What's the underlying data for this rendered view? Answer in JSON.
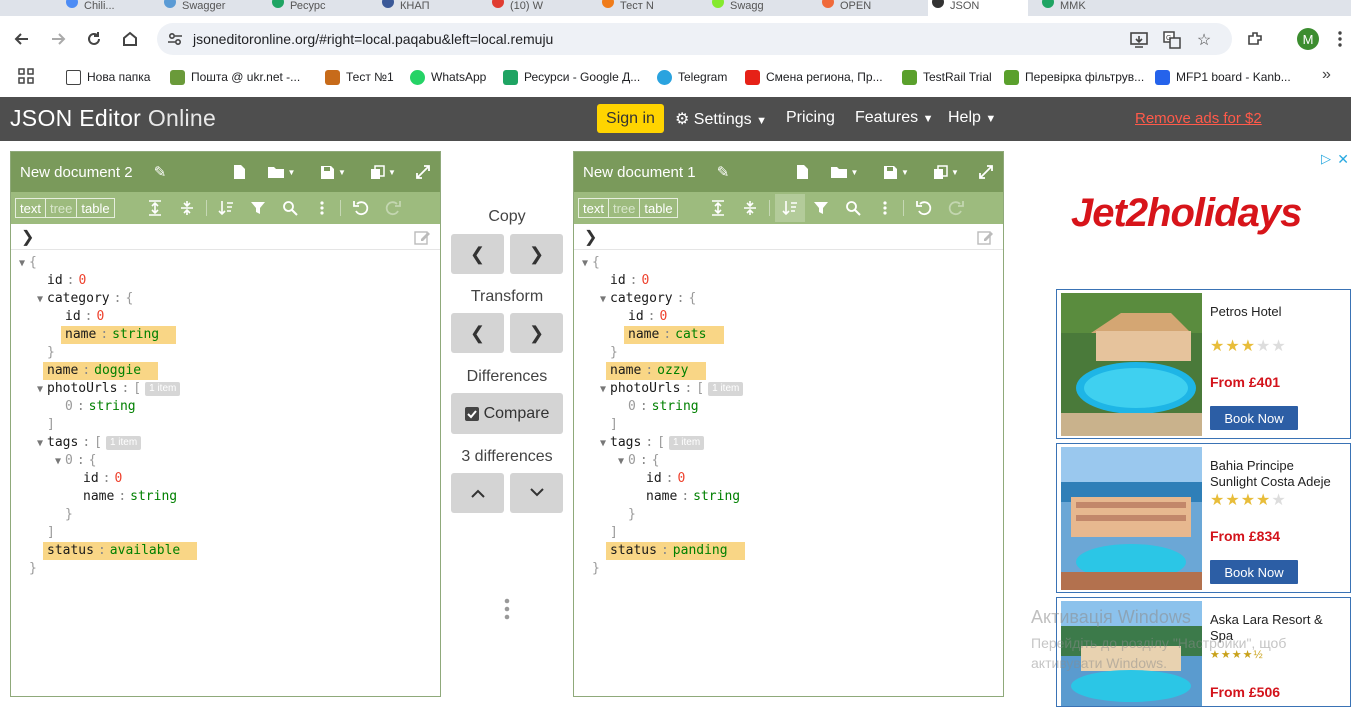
{
  "browser": {
    "tabs": [
      {
        "label": "Chili...",
        "color": "#4d8cf5"
      },
      {
        "label": "Swagger",
        "color": "#5b9bd5"
      },
      {
        "label": "Ресурс",
        "color": "#1fa463"
      },
      {
        "label": "КНАП",
        "color": "#3b5998"
      },
      {
        "label": "(10) W",
        "color": "#e03c31"
      },
      {
        "label": "Тест N",
        "color": "#f07c1a"
      },
      {
        "label": "Swagg",
        "color": "#85ea2d"
      },
      {
        "label": "OPEN",
        "color": "#f06a3a"
      },
      {
        "label": "JSON",
        "color": "#333333"
      },
      {
        "label": "MMK",
        "color": "#1fa463"
      }
    ],
    "url": "jsoneditoronline.org/#right=local.paqabu&left=local.remuju",
    "profile_initial": "M",
    "bookmarks": [
      {
        "label": "Нова папка",
        "icon": "folder-icon",
        "color": "#444444"
      },
      {
        "label": "Пошта @ ukr.net -...",
        "icon": "mail-icon",
        "color": "#6a9a3a"
      },
      {
        "label": "Тест №1",
        "icon": "test-icon",
        "color": "#c76b1a"
      },
      {
        "label": "WhatsApp",
        "icon": "whatsapp-icon",
        "color": "#25d366"
      },
      {
        "label": "Ресурси - Google Д...",
        "icon": "sheets-icon",
        "color": "#1fa463"
      },
      {
        "label": "Telegram",
        "icon": "telegram-icon",
        "color": "#2aa3df"
      },
      {
        "label": "Смена региона, Пр...",
        "icon": "youtube-icon",
        "color": "#e62117"
      },
      {
        "label": "TestRail Trial",
        "icon": "testrail-icon",
        "color": "#5aa02c"
      },
      {
        "label": "Перевірка фільтрув...",
        "icon": "testrail-icon",
        "color": "#5aa02c"
      },
      {
        "label": "MFP1 board - Kanb...",
        "icon": "jira-icon",
        "color": "#2563eb"
      }
    ]
  },
  "app": {
    "brand_bold": "JSON Editor",
    "brand_light": "Online",
    "signin": "Sign in",
    "menu": {
      "settings": "Settings",
      "pricing": "Pricing",
      "features": "Features",
      "help": "Help",
      "remove_ads": "Remove ads for $2"
    }
  },
  "left_panel": {
    "title": "New document 2",
    "modes": [
      "text",
      "tree",
      "table"
    ],
    "active_mode": "tree",
    "rows": [
      {
        "indent": 0,
        "toggle": "down",
        "content": "{"
      },
      {
        "indent": 1,
        "key": "id",
        "value": "0",
        "type": "num"
      },
      {
        "indent": 1,
        "toggle": "down",
        "key": "category",
        "content": "{"
      },
      {
        "indent": 2,
        "key": "id",
        "value": "0",
        "type": "num"
      },
      {
        "indent": 2,
        "key": "name",
        "value": "string",
        "type": "str",
        "diff": true
      },
      {
        "indent": 1,
        "content": "}"
      },
      {
        "indent": 1,
        "key": "name",
        "value": "doggie",
        "type": "str",
        "diff": true
      },
      {
        "indent": 1,
        "toggle": "down",
        "key": "photoUrls",
        "content": "[",
        "count": "1 item"
      },
      {
        "indent": 2,
        "key": "0",
        "value": "string",
        "type": "str",
        "index": true
      },
      {
        "indent": 1,
        "content": "]"
      },
      {
        "indent": 1,
        "toggle": "down",
        "key": "tags",
        "content": "[",
        "count": "1 item"
      },
      {
        "indent": 2,
        "toggle": "down",
        "key": "0",
        "content": "{",
        "index": true
      },
      {
        "indent": 3,
        "key": "id",
        "value": "0",
        "type": "num"
      },
      {
        "indent": 3,
        "key": "name",
        "value": "string",
        "type": "str"
      },
      {
        "indent": 2,
        "content": "}"
      },
      {
        "indent": 1,
        "content": "]"
      },
      {
        "indent": 1,
        "key": "status",
        "value": "available",
        "type": "str",
        "diff": true
      },
      {
        "indent": 0,
        "content": "}"
      }
    ]
  },
  "right_panel": {
    "title": "New document 1",
    "modes": [
      "text",
      "tree",
      "table"
    ],
    "active_mode": "tree",
    "rows": [
      {
        "indent": 0,
        "toggle": "down",
        "content": "{"
      },
      {
        "indent": 1,
        "key": "id",
        "value": "0",
        "type": "num"
      },
      {
        "indent": 1,
        "toggle": "down",
        "key": "category",
        "content": "{"
      },
      {
        "indent": 2,
        "key": "id",
        "value": "0",
        "type": "num"
      },
      {
        "indent": 2,
        "key": "name",
        "value": "cats",
        "type": "str",
        "diff": true
      },
      {
        "indent": 1,
        "content": "}"
      },
      {
        "indent": 1,
        "key": "name",
        "value": "ozzy",
        "type": "str",
        "diff": true
      },
      {
        "indent": 1,
        "toggle": "down",
        "key": "photoUrls",
        "content": "[",
        "count": "1 item"
      },
      {
        "indent": 2,
        "key": "0",
        "value": "string",
        "type": "str",
        "index": true
      },
      {
        "indent": 1,
        "content": "]"
      },
      {
        "indent": 1,
        "toggle": "down",
        "key": "tags",
        "content": "[",
        "count": "1 item"
      },
      {
        "indent": 2,
        "toggle": "down",
        "key": "0",
        "content": "{",
        "index": true
      },
      {
        "indent": 3,
        "key": "id",
        "value": "0",
        "type": "num"
      },
      {
        "indent": 3,
        "key": "name",
        "value": "string",
        "type": "str"
      },
      {
        "indent": 2,
        "content": "}"
      },
      {
        "indent": 1,
        "content": "]"
      },
      {
        "indent": 1,
        "key": "status",
        "value": "panding",
        "type": "str",
        "diff": true
      },
      {
        "indent": 0,
        "content": "}"
      }
    ]
  },
  "middle": {
    "copy_label": "Copy",
    "transform_label": "Transform",
    "differences_label": "Differences",
    "compare_label": "Compare",
    "diff_count": "3 differences"
  },
  "ad": {
    "brand": "Jet2holidays",
    "hotels": [
      {
        "name": "Petros Hotel",
        "stars": 3,
        "price": "From £401",
        "book": "Book Now"
      },
      {
        "name": "Bahia Principe Sunlight Costa Adeje",
        "stars": 4,
        "price": "From £834",
        "book": "Book Now"
      },
      {
        "name": "Aska Lara Resort & Spa",
        "stars": 4.5,
        "price": "From £506",
        "book": ""
      }
    ]
  },
  "watermark": {
    "line1": "Активація Windows",
    "line2": "Перейдіть до розділу \"Настройки\", щоб",
    "line3": "активувати Windows."
  }
}
